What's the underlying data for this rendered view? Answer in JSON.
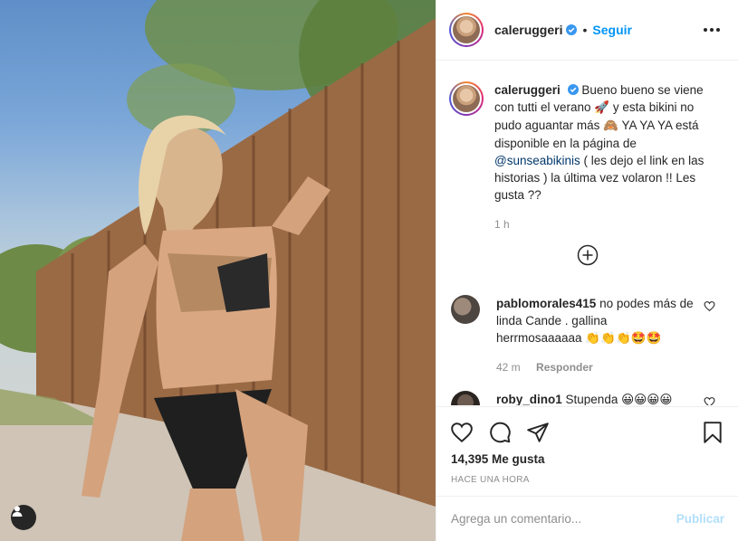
{
  "post": {
    "username": "caleruggeri",
    "follow_label": "Seguir",
    "separator": "•"
  },
  "caption": {
    "username": "caleruggeri",
    "text_1": "Bueno bueno se viene con tutti el verano",
    "emoji_1": "🚀",
    "text_2": "y esta bikini no pudo aguantar más",
    "emoji_2": "🙈",
    "text_3": "YA YA YA está disponible en la página de",
    "mention": "@sunseabikinis",
    "text_4": "( les dejo el link en las historias ) la última vez volaron !! Les gusta ??",
    "time": "1 h"
  },
  "comments": [
    {
      "username": "pablomorales415",
      "text": "no podes más de linda Cande . gallina herrmosaaaaaa",
      "emojis": "👏👏👏🤩🤩",
      "time": "42 m",
      "reply_label": "Responder"
    },
    {
      "username": "roby_dino1",
      "text": "Stupenda",
      "emojis": "😀😀😀😀"
    }
  ],
  "stats": {
    "likes": "14,395 Me gusta",
    "posted": "HACE UNA HORA"
  },
  "compose": {
    "placeholder": "Agrega un comentario...",
    "publish_label": "Publicar"
  },
  "icons": {
    "more": "more-options-icon",
    "verified": "verified-badge-icon",
    "load_more": "plus-circle-icon",
    "like": "heart-icon",
    "comment": "comment-bubble-icon",
    "share": "paper-plane-icon",
    "save": "bookmark-icon",
    "user_tag": "user-tag-icon"
  },
  "colors": {
    "accent": "#0095f6",
    "verified": "#3897f0",
    "publish_disabled": "#b2dffc",
    "mention": "#00376b"
  }
}
